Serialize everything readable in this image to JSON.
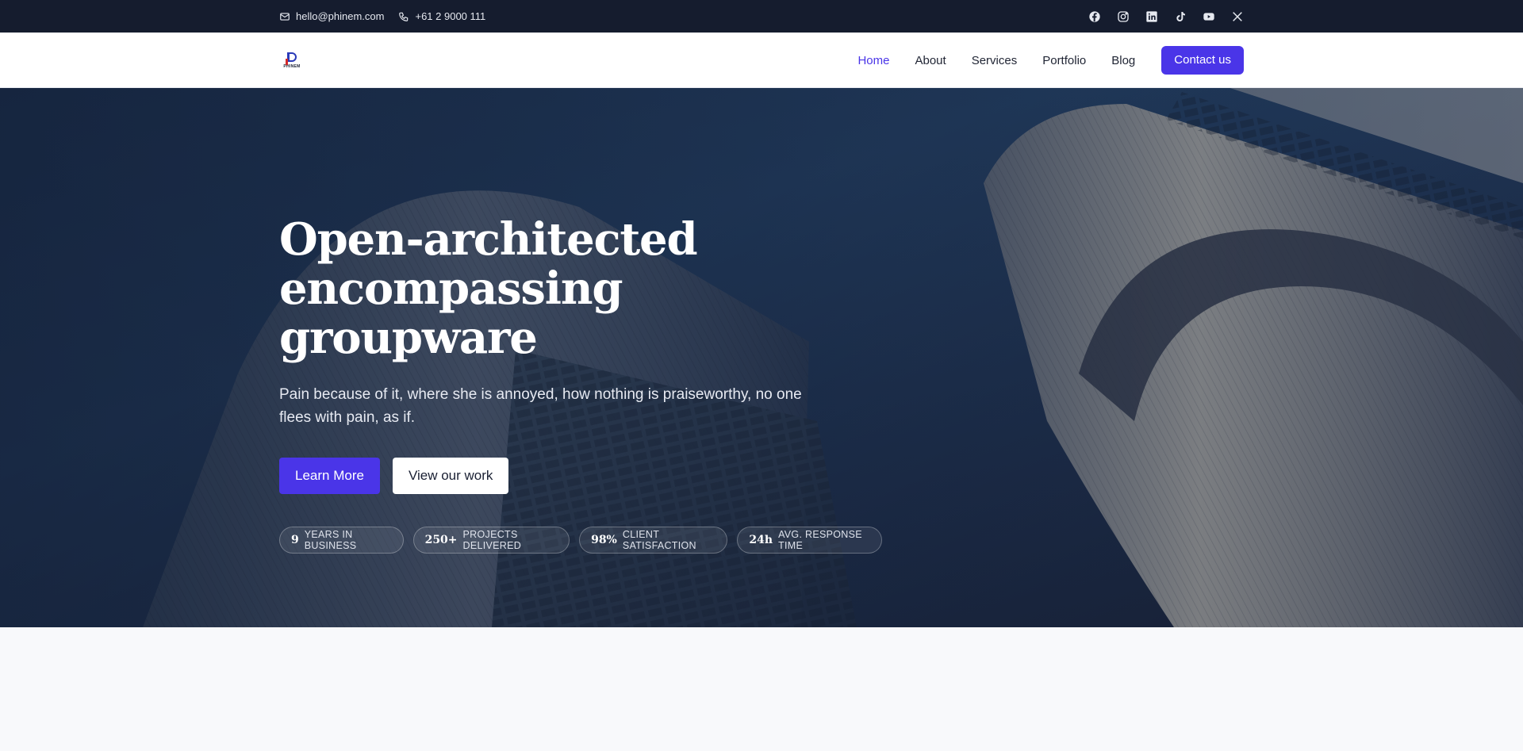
{
  "topbar": {
    "email": "hello@phinem.com",
    "phone": "+61 2 9000 111",
    "social": [
      "facebook-icon",
      "instagram-icon",
      "linkedin-icon",
      "tiktok-icon",
      "youtube-icon",
      "x-icon"
    ]
  },
  "nav": {
    "logo_text": "PHINEM",
    "links": [
      "Home",
      "About",
      "Services",
      "Portfolio",
      "Blog"
    ],
    "active": "Home",
    "cta": "Contact us"
  },
  "hero": {
    "title_line1": "Open-architected",
    "title_line2": "encompassing groupware",
    "subtitle": "Pain because of it, where she is annoyed, how nothing is praiseworthy, no one flees with pain, as if.",
    "primary_button": "Learn More",
    "secondary_button": "View our work",
    "stats": [
      {
        "value": "9",
        "label": "YEARS IN BUSINESS"
      },
      {
        "value": "250+",
        "label": "PROJECTS DELIVERED"
      },
      {
        "value": "98%",
        "label": "CLIENT SATISFACTION"
      },
      {
        "value": "24h",
        "label": "AVG. RESPONSE TIME"
      }
    ]
  },
  "colors": {
    "topbar_bg": "#151c2e",
    "accent": "#4a35e8",
    "hero_bg": "#1d3556"
  }
}
